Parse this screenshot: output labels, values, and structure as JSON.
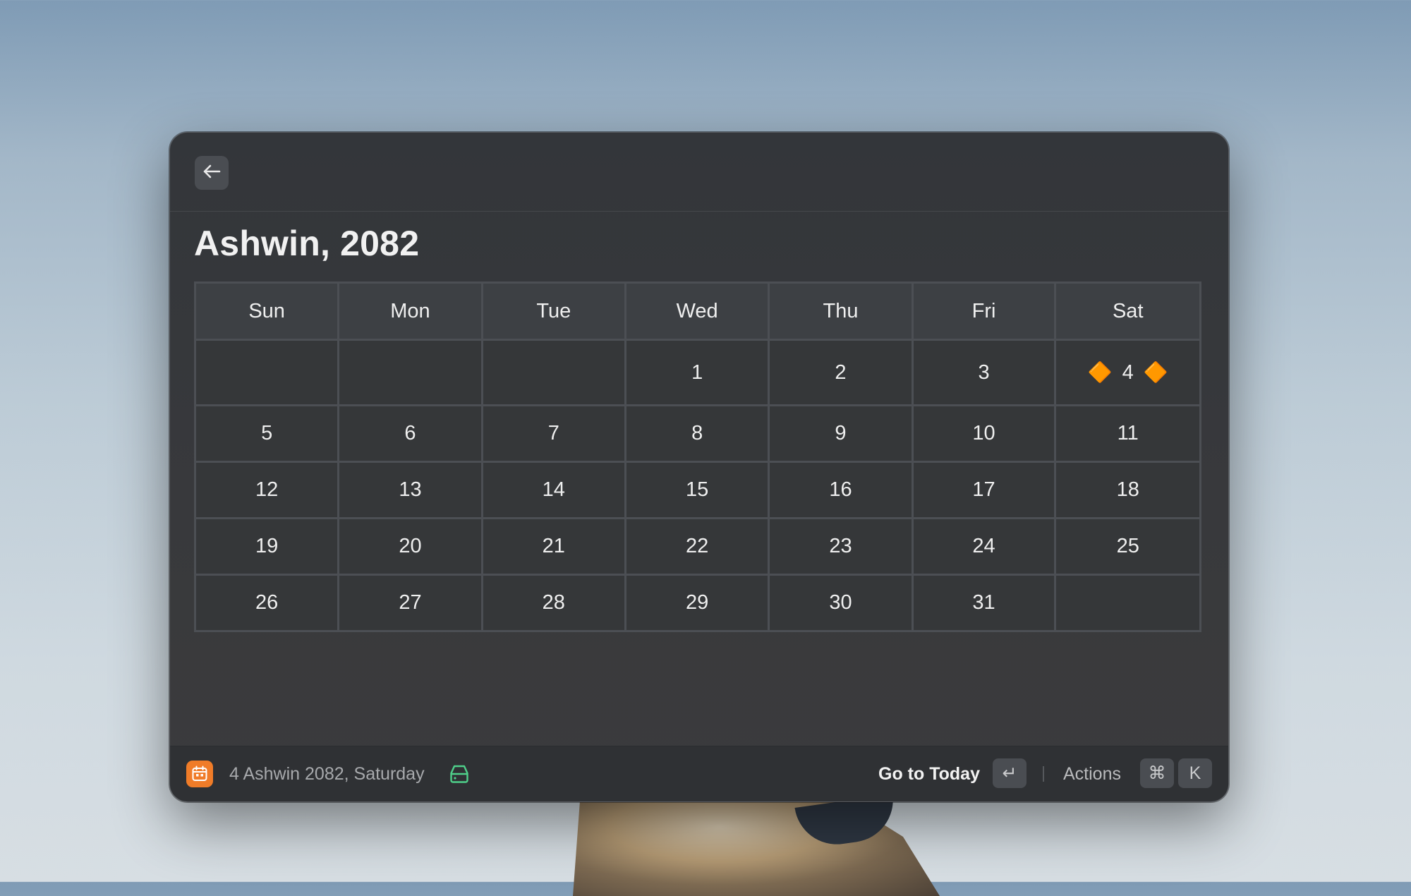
{
  "window": {
    "title": "Ashwin, 2082",
    "back_icon": "arrow-left-icon"
  },
  "calendar": {
    "weekdays": [
      "Sun",
      "Mon",
      "Tue",
      "Wed",
      "Thu",
      "Fri",
      "Sat"
    ],
    "weeks": [
      [
        "",
        "",
        "",
        "1",
        "2",
        "3",
        "4"
      ],
      [
        "5",
        "6",
        "7",
        "8",
        "9",
        "10",
        "11"
      ],
      [
        "12",
        "13",
        "14",
        "15",
        "16",
        "17",
        "18"
      ],
      [
        "19",
        "20",
        "21",
        "22",
        "23",
        "24",
        "25"
      ],
      [
        "26",
        "27",
        "28",
        "29",
        "30",
        "31",
        ""
      ]
    ],
    "today_marker": "🔶",
    "accent_color": "#f0a033"
  },
  "footer": {
    "app_icon": "calendar-icon",
    "app_icon_color": "#f07c28",
    "status": "4 Ashwin 2082, Saturday",
    "status_icon": "drive-icon",
    "primary_action": "Go to Today",
    "primary_key": "↵",
    "secondary_action": "Actions",
    "secondary_keys": [
      "⌘",
      "K"
    ]
  }
}
